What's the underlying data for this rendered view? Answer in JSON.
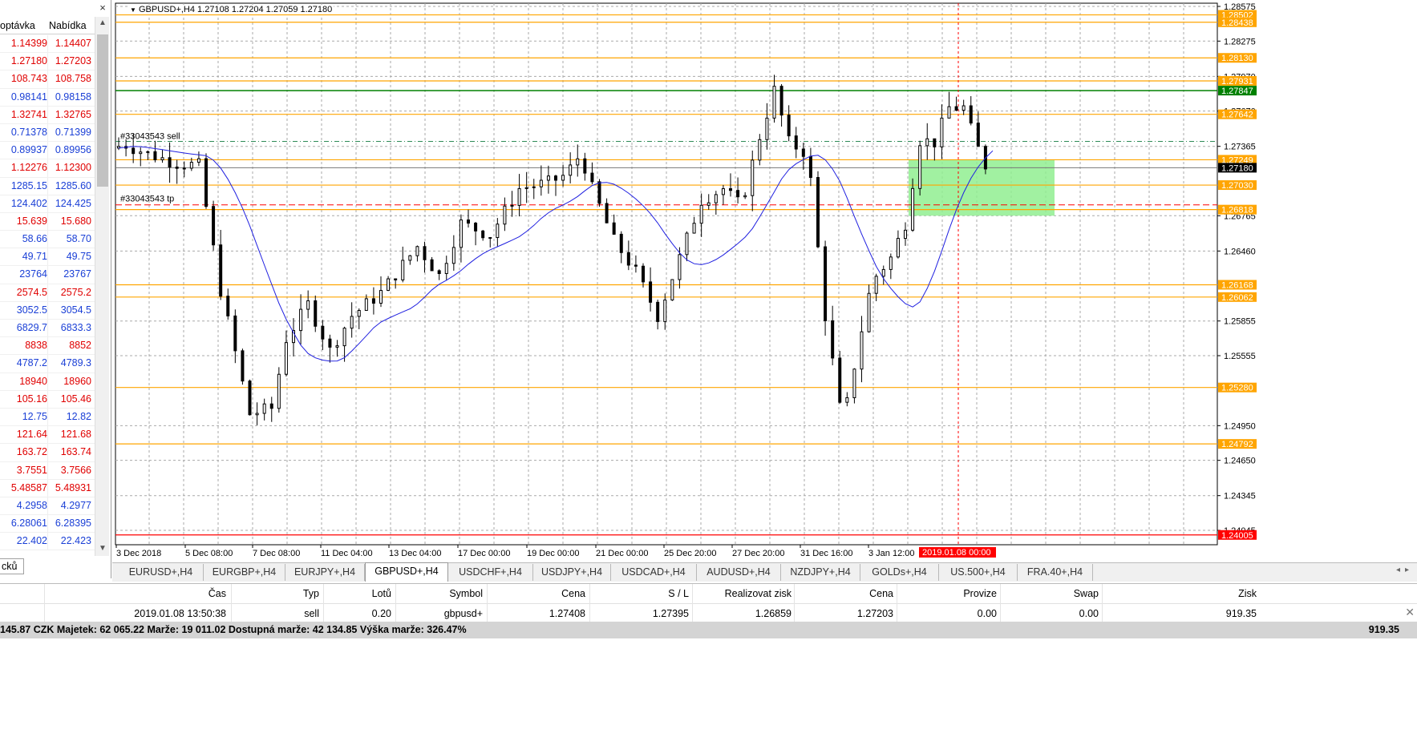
{
  "market_watch": {
    "close_icon": "×",
    "header": {
      "bid": "optávka",
      "ask": "Nabídka"
    },
    "rows": [
      {
        "bid": "1.14399",
        "ask": "1.14407",
        "dir": "down"
      },
      {
        "bid": "1.27180",
        "ask": "1.27203",
        "dir": "down"
      },
      {
        "bid": "108.743",
        "ask": "108.758",
        "dir": "down"
      },
      {
        "bid": "0.98141",
        "ask": "0.98158",
        "dir": "up"
      },
      {
        "bid": "1.32741",
        "ask": "1.32765",
        "dir": "down"
      },
      {
        "bid": "0.71378",
        "ask": "0.71399",
        "dir": "up"
      },
      {
        "bid": "0.89937",
        "ask": "0.89956",
        "dir": "up"
      },
      {
        "bid": "1.12276",
        "ask": "1.12300",
        "dir": "down"
      },
      {
        "bid": "1285.15",
        "ask": "1285.60",
        "dir": "up"
      },
      {
        "bid": "124.402",
        "ask": "124.425",
        "dir": "up"
      },
      {
        "bid": "15.639",
        "ask": "15.680",
        "dir": "down"
      },
      {
        "bid": "58.66",
        "ask": "58.70",
        "dir": "up"
      },
      {
        "bid": "49.71",
        "ask": "49.75",
        "dir": "up"
      },
      {
        "bid": "23764",
        "ask": "23767",
        "dir": "up"
      },
      {
        "bid": "2574.5",
        "ask": "2575.2",
        "dir": "down"
      },
      {
        "bid": "3052.5",
        "ask": "3054.5",
        "dir": "up"
      },
      {
        "bid": "6829.7",
        "ask": "6833.3",
        "dir": "up"
      },
      {
        "bid": "8838",
        "ask": "8852",
        "dir": "down"
      },
      {
        "bid": "4787.2",
        "ask": "4789.3",
        "dir": "up"
      },
      {
        "bid": "18940",
        "ask": "18960",
        "dir": "down"
      },
      {
        "bid": "105.16",
        "ask": "105.46",
        "dir": "down"
      },
      {
        "bid": "12.75",
        "ask": "12.82",
        "dir": "up"
      },
      {
        "bid": "121.64",
        "ask": "121.68",
        "dir": "down"
      },
      {
        "bid": "163.72",
        "ask": "163.74",
        "dir": "down"
      },
      {
        "bid": "3.7551",
        "ask": "3.7566",
        "dir": "down"
      },
      {
        "bid": "5.48587",
        "ask": "5.48931",
        "dir": "down"
      },
      {
        "bid": "4.2958",
        "ask": "4.2977",
        "dir": "up"
      },
      {
        "bid": "6.28061",
        "ask": "6.28395",
        "dir": "up"
      },
      {
        "bid": "22.402",
        "ask": "22.423",
        "dir": "up"
      }
    ],
    "bottom_tab": "cků"
  },
  "chart": {
    "info": "GBPUSD+,H4  1.27108 1.27204 1.27059 1.27180",
    "order_labels": {
      "sell": "#33043543 sell",
      "tp": "#33043543 tp"
    },
    "price_ticks": [
      {
        "label": "1.28575",
        "price": 1.28575
      },
      {
        "label": "1.28275",
        "price": 1.28275
      },
      {
        "label": "1.27970",
        "price": 1.2797
      },
      {
        "label": "1.27670",
        "price": 1.2767
      },
      {
        "label": "1.27365",
        "price": 1.27365
      },
      {
        "label": "1.26765",
        "price": 1.26765
      },
      {
        "label": "1.26460",
        "price": 1.2646
      },
      {
        "label": "1.25855",
        "price": 1.25855
      },
      {
        "label": "1.25555",
        "price": 1.25555
      },
      {
        "label": "1.24950",
        "price": 1.2495
      },
      {
        "label": "1.24650",
        "price": 1.2465
      },
      {
        "label": "1.24345",
        "price": 1.24345
      },
      {
        "label": "1.24045",
        "price": 1.24045
      }
    ],
    "level_tags": [
      {
        "label": "1.28502",
        "price": 1.28502,
        "color": "#ffa500"
      },
      {
        "label": "1.28438",
        "price": 1.28438,
        "color": "#ffa500"
      },
      {
        "label": "1.28130",
        "price": 1.2813,
        "color": "#ffa500"
      },
      {
        "label": "1.27931",
        "price": 1.27931,
        "color": "#ffa500"
      },
      {
        "label": "1.27847",
        "price": 1.27847,
        "color": "#008000"
      },
      {
        "label": "1.27642",
        "price": 1.27642,
        "color": "#ffa500"
      },
      {
        "label": "1.27249",
        "price": 1.27249,
        "color": "#ffa500"
      },
      {
        "label": "1.27180",
        "price": 1.2718,
        "color": "#000000"
      },
      {
        "label": "1.27030",
        "price": 1.2703,
        "color": "#ffa500"
      },
      {
        "label": "1.26818",
        "price": 1.26818,
        "color": "#ffa500"
      },
      {
        "label": "1.26168",
        "price": 1.26168,
        "color": "#ffa500"
      },
      {
        "label": "1.26062",
        "price": 1.26062,
        "color": "#ffa500"
      },
      {
        "label": "1.25280",
        "price": 1.2528,
        "color": "#ffa500"
      },
      {
        "label": "1.24792",
        "price": 1.24792,
        "color": "#ffa500"
      },
      {
        "label": "1.24005",
        "price": 1.24005,
        "color": "#ff0000"
      }
    ],
    "time_ticks": [
      "3 Dec 2018",
      "5 Dec 08:00",
      "7 Dec 08:00",
      "11 Dec 04:00",
      "13 Dec 04:00",
      "17 Dec 00:00",
      "19 Dec 00:00",
      "21 Dec 00:00",
      "25 Dec 20:00",
      "27 Dec 20:00",
      "31 Dec 16:00",
      "3 Jan 12:00"
    ],
    "cursor_time": "2019.01.08 00:00",
    "colors": {
      "level": "#ffa500",
      "support": "#008000",
      "ma": "#2020e0",
      "zone": "#90ee90",
      "cursor": "#ff0000"
    }
  },
  "tabs": {
    "items": [
      "EURUSD+,H4",
      "EURGBP+,H4",
      "EURJPY+,H4",
      "GBPUSD+,H4",
      "USDCHF+,H4",
      "USDJPY+,H4",
      "USDCAD+,H4",
      "AUDUSD+,H4",
      "NZDJPY+,H4",
      "GOLDs+,H4",
      "US.500+,H4",
      "FRA.40+,H4"
    ],
    "active": 3,
    "nav": "◂▸"
  },
  "trade": {
    "headers": {
      "cas": "Čas",
      "typ": "Typ",
      "lotu": "Lotů",
      "symbol": "Symbol",
      "cena": "Cena",
      "sl": "S / L",
      "tp": "Realizovat zisk",
      "cena2": "Cena",
      "provize": "Provize",
      "swap": "Swap",
      "zisk": "Zisk"
    },
    "row": {
      "cas": "2019.01.08 13:50:38",
      "typ": "sell",
      "lotu": "0.20",
      "symbol": "gbpusd+",
      "cena": "1.27408",
      "sl": "1.27395",
      "tp": "1.26859",
      "cena2": "1.27203",
      "provize": "0.00",
      "swap": "0.00",
      "zisk": "919.35"
    },
    "close_icon": "✕",
    "status": "145.87 CZK  Majetek: 62 065.22  Marže: 19 011.02  Dostupná marže: 42 134.85  Výška marže: 326.47%",
    "status_pl": "919.35"
  }
}
